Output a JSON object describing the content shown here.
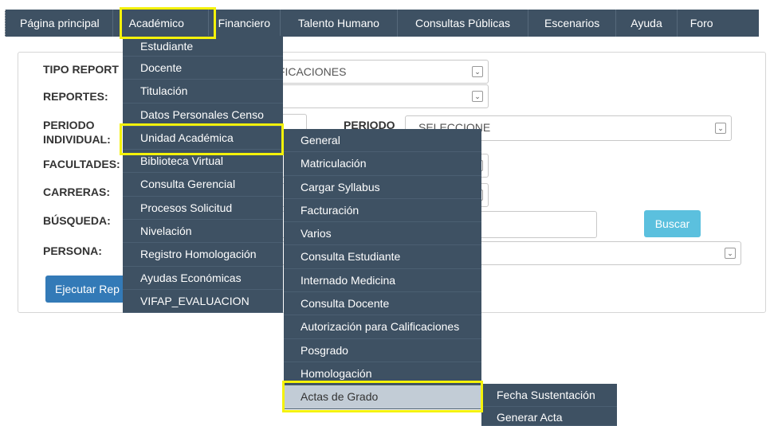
{
  "nav": {
    "items": [
      "Página principal",
      "Académico",
      "Financiero",
      "Talento Humano",
      "Consultas Públicas",
      "Escenarios",
      "Ayuda",
      "Foro"
    ]
  },
  "form": {
    "tipo_reporte_label": "TIPO REPORT",
    "tipo_reporte_value": "IFICACIONES",
    "reportes_label": "REPORTES:",
    "periodo_individual_label_1": "PERIODO",
    "periodo_individual_label_2": "INDIVIDUAL:",
    "periodo_label": "PERIODO",
    "periodo_value": "SELECCIONE",
    "facultades_label": "FACULTADES:",
    "carreras_label": "CARRERAS:",
    "busqueda_label": "BÚSQUEDA:",
    "persona_label": "PERSONA:",
    "buscar_button": "Buscar",
    "ejecutar_button": "Ejecutar Rep"
  },
  "menu_academico": [
    "Estudiante",
    "Docente",
    "Titulación",
    "Datos Personales Censo",
    "Unidad Académica",
    "Biblioteca Virtual",
    "Consulta Gerencial",
    "Procesos Solicitud",
    "Nivelación",
    "Registro Homologación",
    "Ayudas Económicas",
    "VIFAP_EVALUACION"
  ],
  "menu_unidad_academica": [
    "General",
    "Matriculación",
    "Cargar Syllabus",
    "Facturación",
    "Varios",
    "Consulta Estudiante",
    "Internado Medicina",
    "Consulta Docente",
    "Autorización para Calificaciones",
    "Posgrado",
    "Homologación",
    "Actas de Grado"
  ],
  "menu_actas_grado": [
    "Fecha Sustentación",
    "Generar Acta"
  ],
  "colors": {
    "menu_bg": "#3e5163",
    "highlight": "#f4f20a",
    "selected_item_bg": "#c2ccd6",
    "buscar_bg": "#5bc0de",
    "ejecutar_bg": "#337ab7"
  }
}
